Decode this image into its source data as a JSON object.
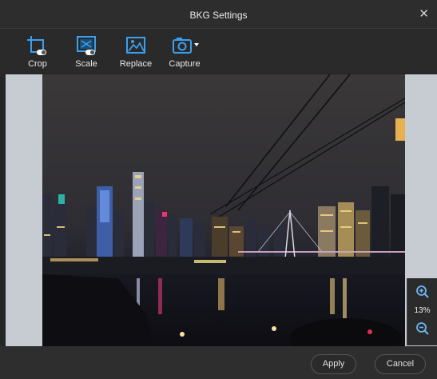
{
  "window": {
    "title": "BKG Settings",
    "close_icon": "close-icon"
  },
  "toolbar": {
    "accent_color": "#3aa0f0",
    "tools": [
      {
        "label": "Crop",
        "icon": "crop-icon"
      },
      {
        "label": "Scale",
        "icon": "scale-icon"
      },
      {
        "label": "Replace",
        "icon": "replace-image-icon"
      },
      {
        "label": "Capture",
        "icon": "camera-icon"
      }
    ]
  },
  "preview": {
    "image": "night city skyline with river and bridge",
    "zoom_level": "13%",
    "zoom_in_icon": "zoom-in-icon",
    "zoom_out_icon": "zoom-out-icon"
  },
  "footer": {
    "apply_label": "Apply",
    "cancel_label": "Cancel"
  }
}
